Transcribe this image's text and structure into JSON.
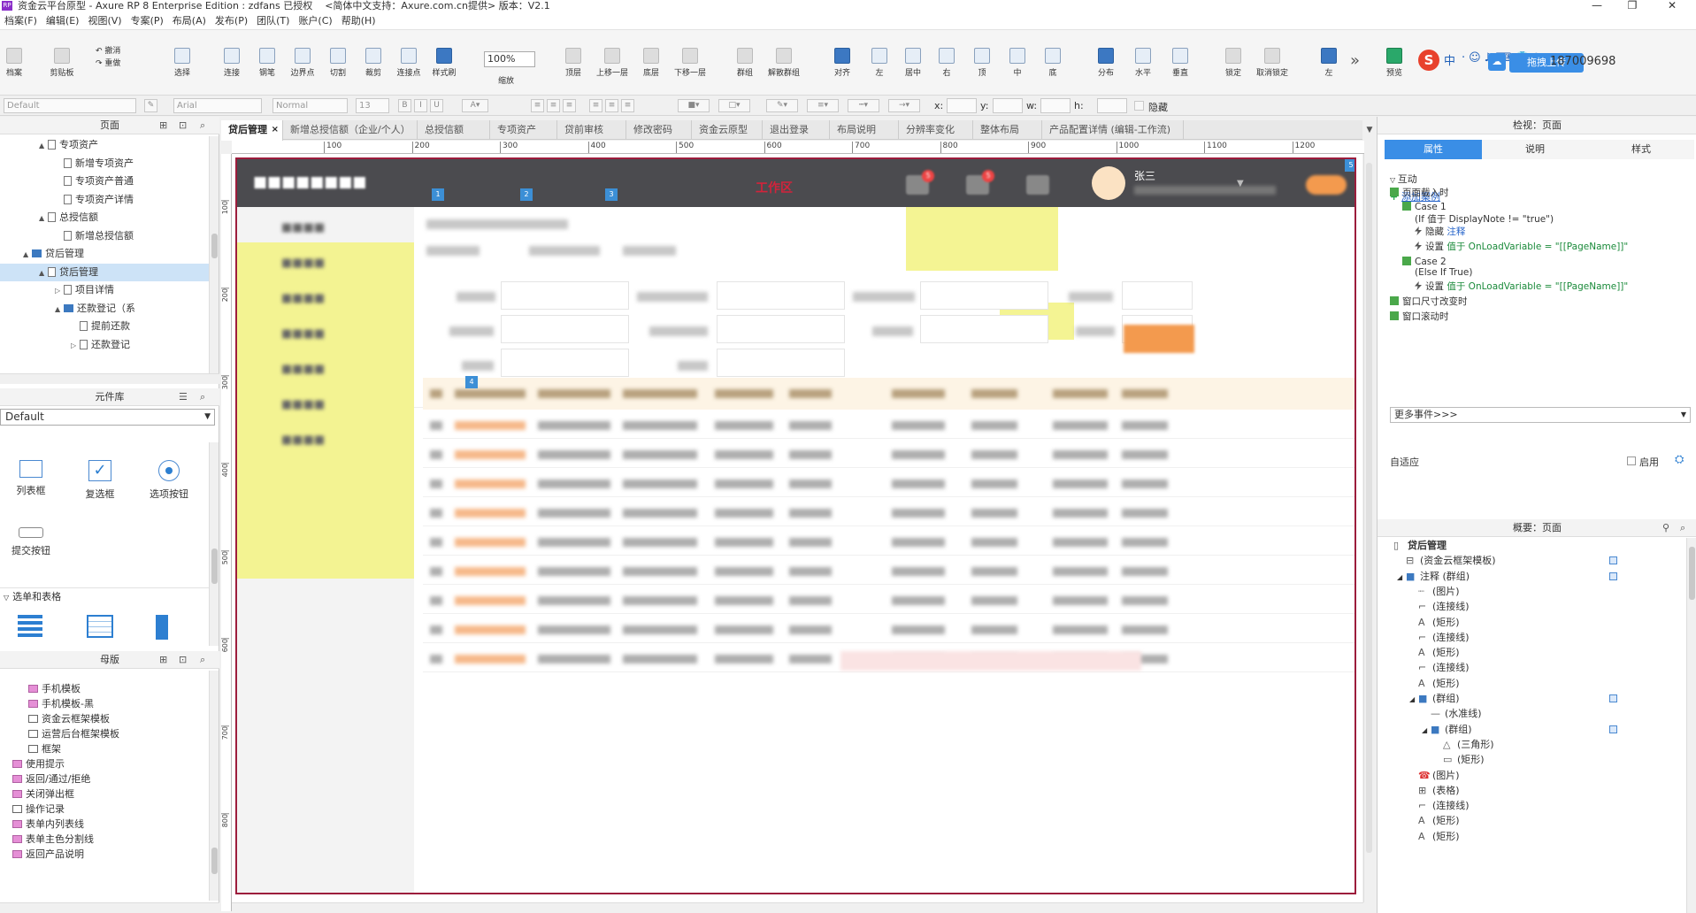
{
  "window": {
    "title": "资金云平台原型 - Axure RP 8 Enterprise Edition : zdfans 已授权",
    "subtitle": "<简体中文支持：Axure.com.cn提供> 版本：V2.1",
    "icon_label": "RP"
  },
  "menu": [
    "档案(F)",
    "编辑(E)",
    "视图(V)",
    "专案(P)",
    "布局(A)",
    "发布(P)",
    "团队(T)",
    "账户(C)",
    "帮助(H)"
  ],
  "toolbar": {
    "file": [
      "档案",
      "剪贴板"
    ],
    "edit": [
      "撤消",
      "重做"
    ],
    "select": [
      "选择",
      "连接",
      "钢笔",
      "边界点",
      "切割",
      "裁剪",
      "连接点",
      "样式刷"
    ],
    "zoom_value": "100%",
    "zoom_label": "缩放",
    "arrange": [
      "顶层",
      "上移一层",
      "底层",
      "下移一层",
      "群组",
      "解散群组",
      "对齐",
      "左",
      "居中",
      "右",
      "顶",
      "中",
      "底",
      "分布",
      "水平",
      "垂直",
      "锁定",
      "取消锁定",
      "左"
    ],
    "preview": "预览",
    "upload_label": "拖拽上传",
    "account": "187009698",
    "ime": "中"
  },
  "format_bar": {
    "style": "Default",
    "font": "Arial",
    "weight": "Normal",
    "size": "13",
    "x_label": "x:",
    "y_label": "y:",
    "w_label": "w:",
    "h_label": "h:",
    "hidden_label": "隐藏"
  },
  "left": {
    "pages_title": "页面",
    "pages": [
      {
        "label": "专项资产",
        "icon": "page",
        "depth": 3,
        "arrow": "▲"
      },
      {
        "label": "新增专项资产",
        "icon": "page",
        "depth": 4
      },
      {
        "label": "专项资产普通",
        "icon": "page",
        "depth": 4
      },
      {
        "label": "专项资产详情",
        "icon": "page",
        "depth": 4
      },
      {
        "label": "总授信额",
        "icon": "page",
        "depth": 3,
        "arrow": "▲"
      },
      {
        "label": "新增总授信额",
        "icon": "page",
        "depth": 4
      },
      {
        "label": "贷后管理",
        "icon": "folder",
        "depth": 2,
        "arrow": "▲"
      },
      {
        "label": "贷后管理",
        "icon": "page",
        "depth": 3,
        "arrow": "▲",
        "selected": true
      },
      {
        "label": "项目详情",
        "icon": "page",
        "depth": 4,
        "arrow": "▷"
      },
      {
        "label": "还款登记（系",
        "icon": "folder",
        "depth": 4,
        "arrow": "▲"
      },
      {
        "label": "提前还款",
        "icon": "page",
        "depth": 5
      },
      {
        "label": "还款登记",
        "icon": "page",
        "depth": 5,
        "arrow": "▷"
      }
    ],
    "library_title": "元件库",
    "library_selected": "Default",
    "widgets": [
      "列表框",
      "复选框",
      "选项按钮",
      "提交按钮"
    ],
    "section_forms": "选单和表格",
    "masters_title": "母版",
    "masters": [
      {
        "label": "手机模板",
        "icon": "master",
        "depth": 2
      },
      {
        "label": "手机模板-黑",
        "icon": "master",
        "depth": 2
      },
      {
        "label": "资金云框架模板",
        "icon": "frame",
        "depth": 2
      },
      {
        "label": "运营后台框架模板",
        "icon": "frame",
        "depth": 2
      },
      {
        "label": "框架",
        "icon": "frame",
        "depth": 2
      },
      {
        "label": "使用提示",
        "icon": "master",
        "depth": 1
      },
      {
        "label": "返回/通过/拒绝",
        "icon": "master",
        "depth": 1
      },
      {
        "label": "关闭弹出框",
        "icon": "master",
        "depth": 1
      },
      {
        "label": "操作记录",
        "icon": "frame",
        "depth": 1
      },
      {
        "label": "表单内列表线",
        "icon": "master",
        "depth": 1
      },
      {
        "label": "表单主色分割线",
        "icon": "master",
        "depth": 1
      },
      {
        "label": "返回产品说明",
        "icon": "master",
        "depth": 1
      }
    ]
  },
  "tabs": [
    "贷后管理",
    "新增总授信额（企业/个人）",
    "总授信额",
    "专项资产",
    "贷前审核",
    "修改密码",
    "资金云原型",
    "退出登录",
    "布局说明",
    "分辨率变化",
    "整体布局",
    "产品配置详情 (编辑-工作流)"
  ],
  "ruler_h": [
    "100",
    "200",
    "300",
    "400",
    "500",
    "600",
    "700",
    "800",
    "900",
    "1000",
    "1100",
    "1200"
  ],
  "ruler_v": [
    "100",
    "200",
    "300",
    "400",
    "500",
    "600",
    "700",
    "800"
  ],
  "canvas": {
    "workspace_title": "工作区",
    "user_name": "张三",
    "badges": [
      "5",
      "5"
    ],
    "note_markers": [
      "1",
      "2",
      "3",
      "4",
      "5"
    ],
    "highlight_color": "#f2f280",
    "header_color": "#4b4b4f",
    "accent_color": "#f39a4e"
  },
  "right": {
    "inspector_title": "检视：页面",
    "tabs": [
      "属性",
      "说明",
      "样式"
    ],
    "interaction": "互动",
    "add_case": "添加案例",
    "events": [
      {
        "kind": "event",
        "label": "页面载入时",
        "depth": 0
      },
      {
        "kind": "case",
        "label": "Case 1",
        "depth": 1
      },
      {
        "kind": "cond",
        "label": "(If 值于 DisplayNote != \"true\")",
        "depth": 2
      },
      {
        "kind": "action",
        "label": "隐藏",
        "target": "注释",
        "depth": 2
      },
      {
        "kind": "action",
        "label": "设置",
        "target": "值于 OnLoadVariable = \"[[PageName]]\"",
        "depth": 2
      },
      {
        "kind": "case",
        "label": "Case 2",
        "depth": 1
      },
      {
        "kind": "cond",
        "label": "(Else If True)",
        "depth": 2
      },
      {
        "kind": "action",
        "label": "设置",
        "target": "值于 OnLoadVariable = \"[[PageName]]\"",
        "depth": 2
      },
      {
        "kind": "event",
        "label": "窗口尺寸改变时",
        "depth": 0
      },
      {
        "kind": "event",
        "label": "窗口滚动时",
        "depth": 0
      }
    ],
    "more_events": "更多事件>>>",
    "adaptive": "自适应",
    "enable": "启用",
    "outline_title": "概要：页面",
    "outline": [
      {
        "label": "贷后管理",
        "icon": "page",
        "depth": 0
      },
      {
        "label": "(资金云框架模板)",
        "icon": "frame",
        "depth": 1
      },
      {
        "label": "注释 (群组)",
        "icon": "folder",
        "depth": 1,
        "arrow": "◢",
        "check": true
      },
      {
        "label": "(图片)",
        "icon": "dots",
        "depth": 2
      },
      {
        "label": "(连接线)",
        "icon": "conn",
        "depth": 2
      },
      {
        "label": "(矩形)",
        "icon": "text",
        "depth": 2
      },
      {
        "label": "(连接线)",
        "icon": "conn",
        "depth": 2
      },
      {
        "label": "(矩形)",
        "icon": "text",
        "depth": 2
      },
      {
        "label": "(连接线)",
        "icon": "conn",
        "depth": 2
      },
      {
        "label": "(矩形)",
        "icon": "text",
        "depth": 2
      },
      {
        "label": "(群组)",
        "icon": "folder",
        "depth": 2,
        "arrow": "◢",
        "check": true
      },
      {
        "label": "(水准线)",
        "icon": "line",
        "depth": 3
      },
      {
        "label": "(群组)",
        "icon": "folder",
        "depth": 3,
        "arrow": "◢",
        "check": true
      },
      {
        "label": "(三角形)",
        "icon": "tri",
        "depth": 4
      },
      {
        "label": "(矩形)",
        "icon": "rect",
        "depth": 4
      },
      {
        "label": "(图片)",
        "icon": "phone",
        "depth": 2
      },
      {
        "label": "(表格)",
        "icon": "table",
        "depth": 2
      },
      {
        "label": "(连接线)",
        "icon": "conn",
        "depth": 2
      },
      {
        "label": "(矩形)",
        "icon": "text",
        "depth": 2
      },
      {
        "label": "(矩形)",
        "icon": "text",
        "depth": 2
      }
    ]
  }
}
